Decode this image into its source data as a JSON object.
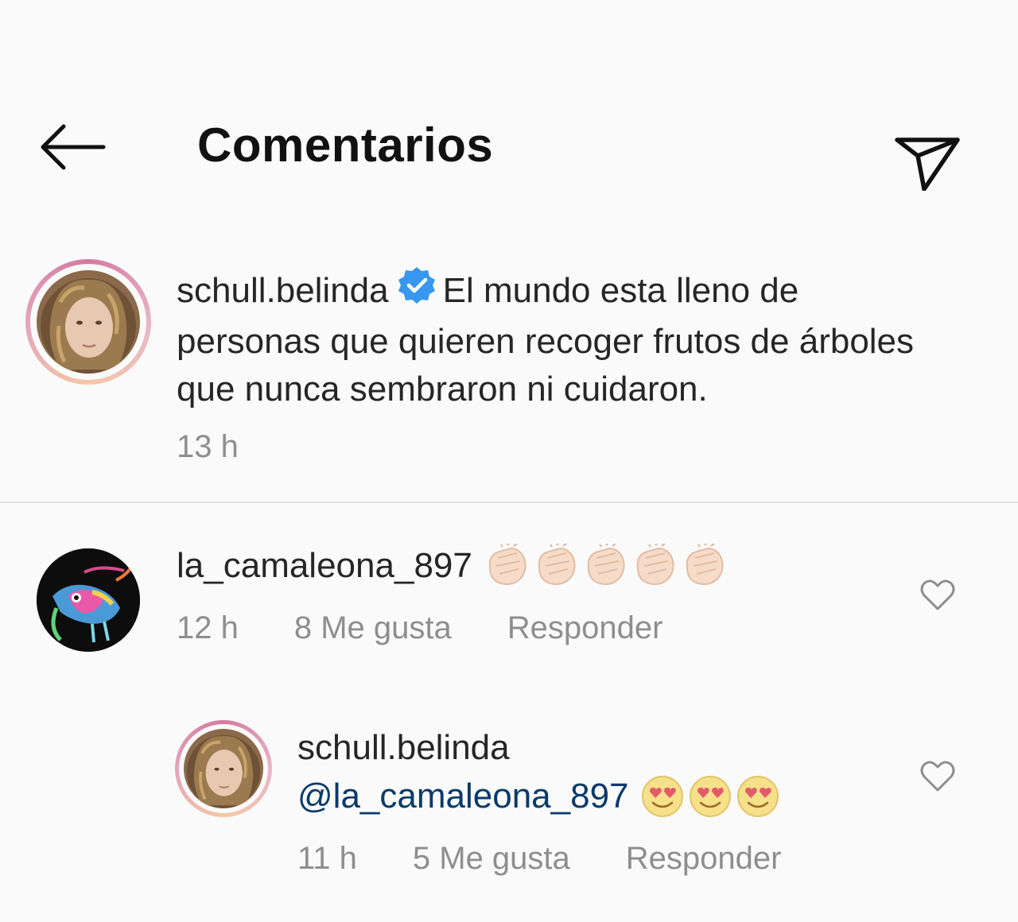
{
  "header": {
    "title": "Comentarios",
    "back_icon": "arrow-left-icon",
    "share_icon": "paper-plane-icon"
  },
  "caption": {
    "username": "schull.belinda",
    "verified": true,
    "text": "El mundo esta lleno de personas que quieren recoger frutos de árboles que nunca sembraron ni cuidaron.",
    "time": "13 h"
  },
  "comments": [
    {
      "username": "la_camaleona_897",
      "emoji": "👏👏👏👏👏",
      "time": "12 h",
      "likes": "8 Me gusta",
      "reply": "Responder"
    }
  ],
  "replies": [
    {
      "username": "schull.belinda",
      "mention": "@la_camaleona_897",
      "emoji": "😍😍😍",
      "time": "11 h",
      "likes": "5 Me gusta",
      "reply": "Responder"
    }
  ],
  "colors": {
    "background": "#fafafa",
    "text": "#262626",
    "secondary": "#8e8e8e",
    "mention": "#0a3a6b",
    "verified": "#3897f0"
  }
}
